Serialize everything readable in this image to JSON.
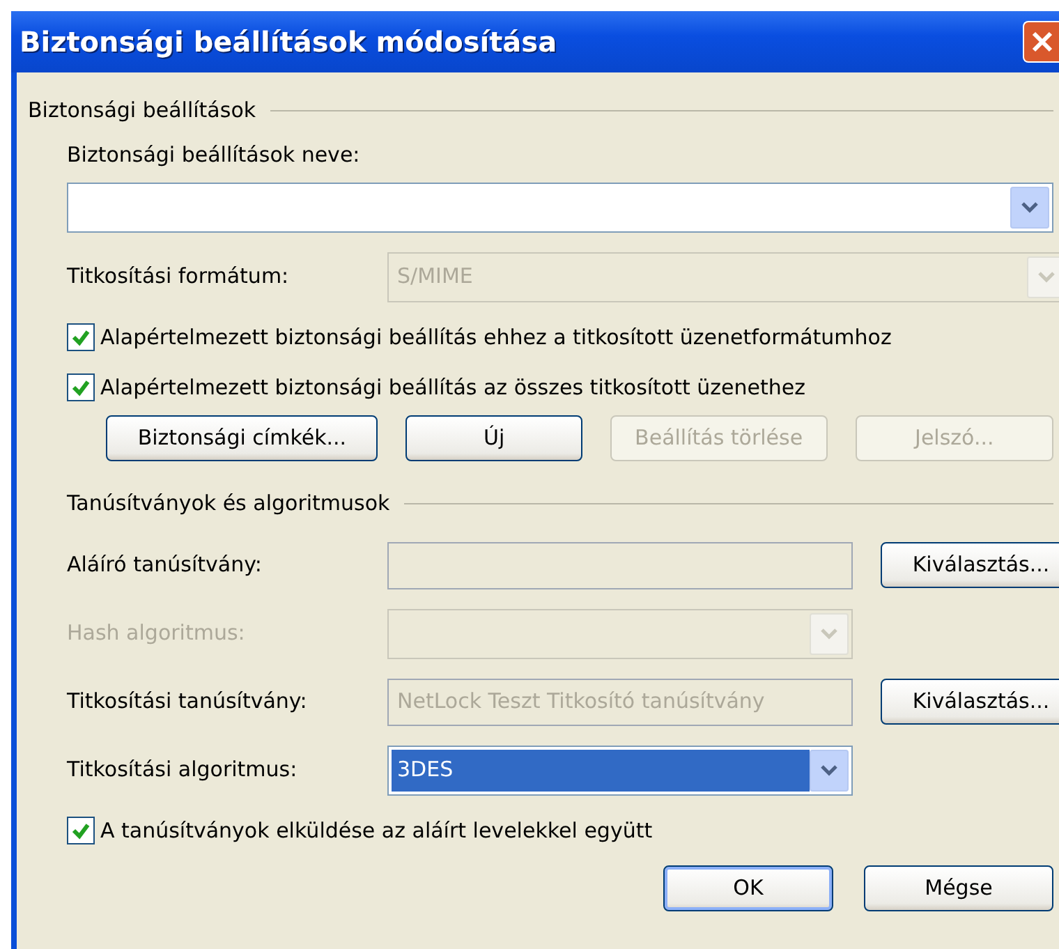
{
  "window": {
    "title": "Biztonsági beállítások módosítása"
  },
  "security_settings": {
    "title": "Biztonsági beállítások",
    "name_label": "Biztonsági beállítások neve:",
    "rows": [
      {
        "kind": "combo",
        "label": "Titkosítási formátum:",
        "value": "S/MIME",
        "label_greyed": false,
        "field_disabled": true,
        "selected": false
      }
    ],
    "checkboxes": [
      {
        "label": "Alapértelmezett biztonsági beállítás ehhez a titkosított üzenetformátumhoz",
        "checked": true
      },
      {
        "label": "Alapértelmezett biztonsági beállítás az összes titkosított üzenethez",
        "checked": true
      }
    ],
    "buttons": [
      {
        "label": "Biztonsági címkék...",
        "disabled": false
      },
      {
        "label": "Új",
        "disabled": false
      },
      {
        "label": "Beállítás törlése",
        "disabled": true
      },
      {
        "label": "Jelszó...",
        "disabled": true
      }
    ]
  },
  "certificates": {
    "title": "Tanúsítványok és algoritmusok",
    "rows": [
      {
        "kind": "text",
        "label": "Aláíró tanúsítvány:",
        "label_greyed": false,
        "field_disabled": true,
        "selected": false,
        "button": "Kiválasztás..."
      },
      {
        "kind": "combo",
        "label": "Hash algoritmus:",
        "label_greyed": true,
        "field_disabled": true,
        "selected": false
      },
      {
        "kind": "text",
        "label": "Titkosítási tanúsítvány:",
        "value": "NetLock Teszt Titkosító tanúsítvány",
        "label_greyed": false,
        "field_disabled": true,
        "selected": false,
        "button": "Kiválasztás..."
      },
      {
        "kind": "combo",
        "label": "Titkosítási algoritmus:",
        "value": "3DES",
        "label_greyed": false,
        "field_disabled": false,
        "selected": true
      }
    ],
    "checkboxes": [
      {
        "label": "A tanúsítványok elküldése az aláírt levelekkel együtt",
        "checked": true
      }
    ]
  },
  "buttons": [
    {
      "label": "OK",
      "default": true
    },
    {
      "label": "Mégse",
      "default": false
    }
  ]
}
